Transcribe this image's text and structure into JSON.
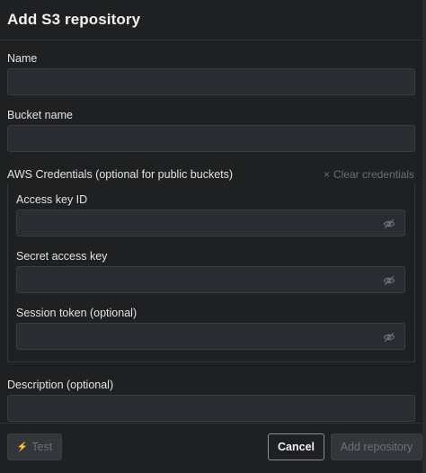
{
  "dialog": {
    "title": "Add S3 repository"
  },
  "fields": {
    "name_label": "Name",
    "name_value": "",
    "bucket_label": "Bucket name",
    "bucket_value": "",
    "description_label": "Description (optional)",
    "description_value": ""
  },
  "credentials": {
    "header": "AWS Credentials (optional for public buckets)",
    "clear_label": "Clear credentials",
    "clear_icon": "×",
    "access_key_label": "Access key ID",
    "access_key_value": "",
    "secret_key_label": "Secret access key",
    "secret_key_value": "",
    "session_token_label": "Session token (optional)",
    "session_token_value": ""
  },
  "footer": {
    "test_label": "Test",
    "test_icon": "⚡",
    "cancel_label": "Cancel",
    "add_label": "Add repository"
  },
  "colors": {
    "background": "#1e2022",
    "input_bg": "#2a2c31",
    "disabled_text": "#6e7176"
  }
}
